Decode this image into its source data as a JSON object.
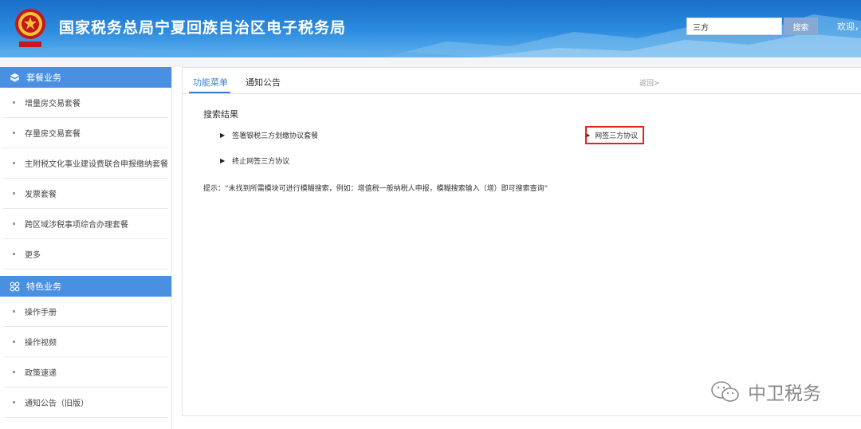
{
  "header": {
    "title": "国家税务总局宁夏回族自治区电子税务局",
    "search_value": "三方",
    "search_button": "搜索",
    "welcome": "欢迎，"
  },
  "sidebar": {
    "sections": [
      {
        "title": "套餐业务",
        "icon": "cube-icon",
        "items": [
          "增量房交易套餐",
          "存量房交易套餐",
          "主附税文化事业建设费联合申报缴纳套餐",
          "发票套餐",
          "跨区域涉税事项综合办理套餐",
          "更多"
        ]
      },
      {
        "title": "特色业务",
        "icon": "grid-icon",
        "items": [
          "操作手册",
          "操作视频",
          "政策速递",
          "通知公告（旧版）"
        ]
      }
    ]
  },
  "main": {
    "tabs": [
      {
        "label": "功能菜单",
        "active": true
      },
      {
        "label": "通知公告",
        "active": false
      }
    ],
    "back_label": "返回>",
    "section_title": "搜索结果",
    "results": [
      "签署银税三方划缴协议套餐",
      "网签三方协议",
      "终止网签三方协议"
    ],
    "hint": "提示：“未找到所需模块可进行模糊搜索，例如：增值税一般纳税人申报，模糊搜索输入（增）即可搜索查询”"
  },
  "watermark": {
    "text": "中卫税务"
  },
  "colors": {
    "accent": "#4a90e2",
    "highlight": "#e0231b",
    "tab_active": "#3a7fd5"
  }
}
